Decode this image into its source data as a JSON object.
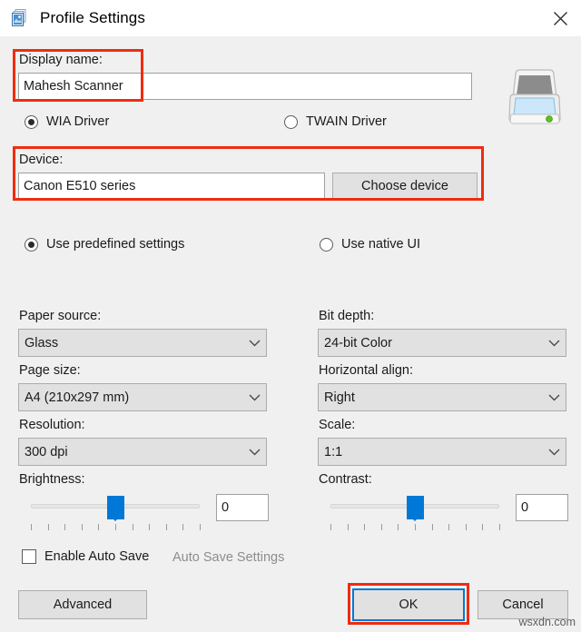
{
  "window": {
    "title": "Profile Settings",
    "icon": "profile-settings-icon",
    "close_label": "✕"
  },
  "form": {
    "display_name": {
      "label": "Display name:",
      "value": "Mahesh Scanner",
      "placeholder": ""
    },
    "driver": {
      "options": [
        {
          "label": "WIA Driver",
          "selected": true
        },
        {
          "label": "TWAIN Driver",
          "selected": false
        }
      ]
    },
    "device": {
      "label": "Device:",
      "value": "Canon E510 series",
      "choose_button": "Choose device"
    },
    "ui_mode": {
      "options": [
        {
          "label": "Use predefined settings",
          "selected": true
        },
        {
          "label": "Use native UI",
          "selected": false
        }
      ]
    },
    "settings_left": [
      {
        "label": "Paper source:",
        "value": "Glass"
      },
      {
        "label": "Page size:",
        "value": "A4 (210x297 mm)"
      },
      {
        "label": "Resolution:",
        "value": "300 dpi"
      }
    ],
    "settings_right": [
      {
        "label": "Bit depth:",
        "value": "24-bit Color"
      },
      {
        "label": "Horizontal align:",
        "value": "Right"
      },
      {
        "label": "Scale:",
        "value": "1:1"
      }
    ],
    "brightness": {
      "label": "Brightness:",
      "value": "0",
      "slider_percent": 50,
      "tick_count": 11
    },
    "contrast": {
      "label": "Contrast:",
      "value": "0",
      "slider_percent": 50,
      "tick_count": 11
    },
    "auto_save": {
      "checkbox_label": "Enable Auto Save",
      "checked": false,
      "settings_link": "Auto Save Settings",
      "settings_link_enabled": false
    }
  },
  "buttons": {
    "advanced": "Advanced",
    "ok": "OK",
    "cancel": "Cancel"
  },
  "annotations": {
    "color": "#f02c10",
    "boxes": [
      "display-name-highlight",
      "device-highlight",
      "ok-highlight"
    ]
  },
  "watermark": "wsxdn.com",
  "colors": {
    "accent": "#0078d7",
    "window_bg": "#f0f0f0",
    "titlebar_bg": "#ffffff",
    "annotation": "#f02c10"
  }
}
